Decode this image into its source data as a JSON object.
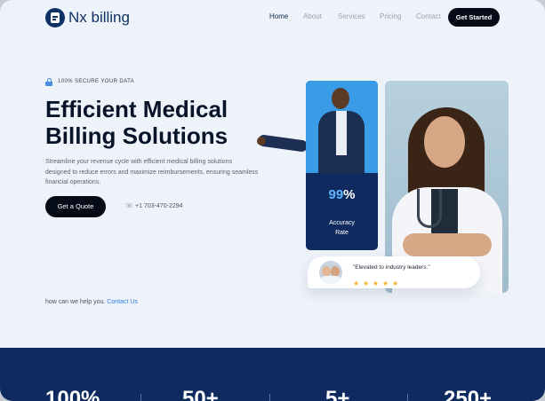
{
  "brand": {
    "name": "Nx billing"
  },
  "nav": {
    "links": [
      {
        "label": "Home"
      },
      {
        "label": "About"
      },
      {
        "label": "Services"
      },
      {
        "label": "Pricing"
      },
      {
        "label": "Contact"
      }
    ],
    "cta": "Get Started"
  },
  "hero": {
    "badge": "100% SECURE YOUR DATA",
    "title": "Efficient Medical Billing Solutions",
    "description": "Streamline your revenue cycle with efficient medical billing solutions designed to reduce errors and maximize reimbursements, ensuring seamless financial operations.",
    "quote_button": "Get a Quote",
    "phone": "+1 703-470-2294",
    "help_text": "how can we help you.",
    "help_link": "Contact Us"
  },
  "accuracy_card": {
    "value": "99",
    "suffix": "%",
    "label_line1": "Accuracy",
    "label_line2": "Rate"
  },
  "review": {
    "quote": "\"Elevated to industry leaders.\"",
    "stars": 5
  },
  "stats": [
    "100%",
    "50+",
    "5+",
    "250+"
  ],
  "colors": {
    "navy": "#0f2a5e",
    "accent_blue": "#2f7fe6",
    "black_button": "#050b17",
    "star": "#f5b52b"
  }
}
